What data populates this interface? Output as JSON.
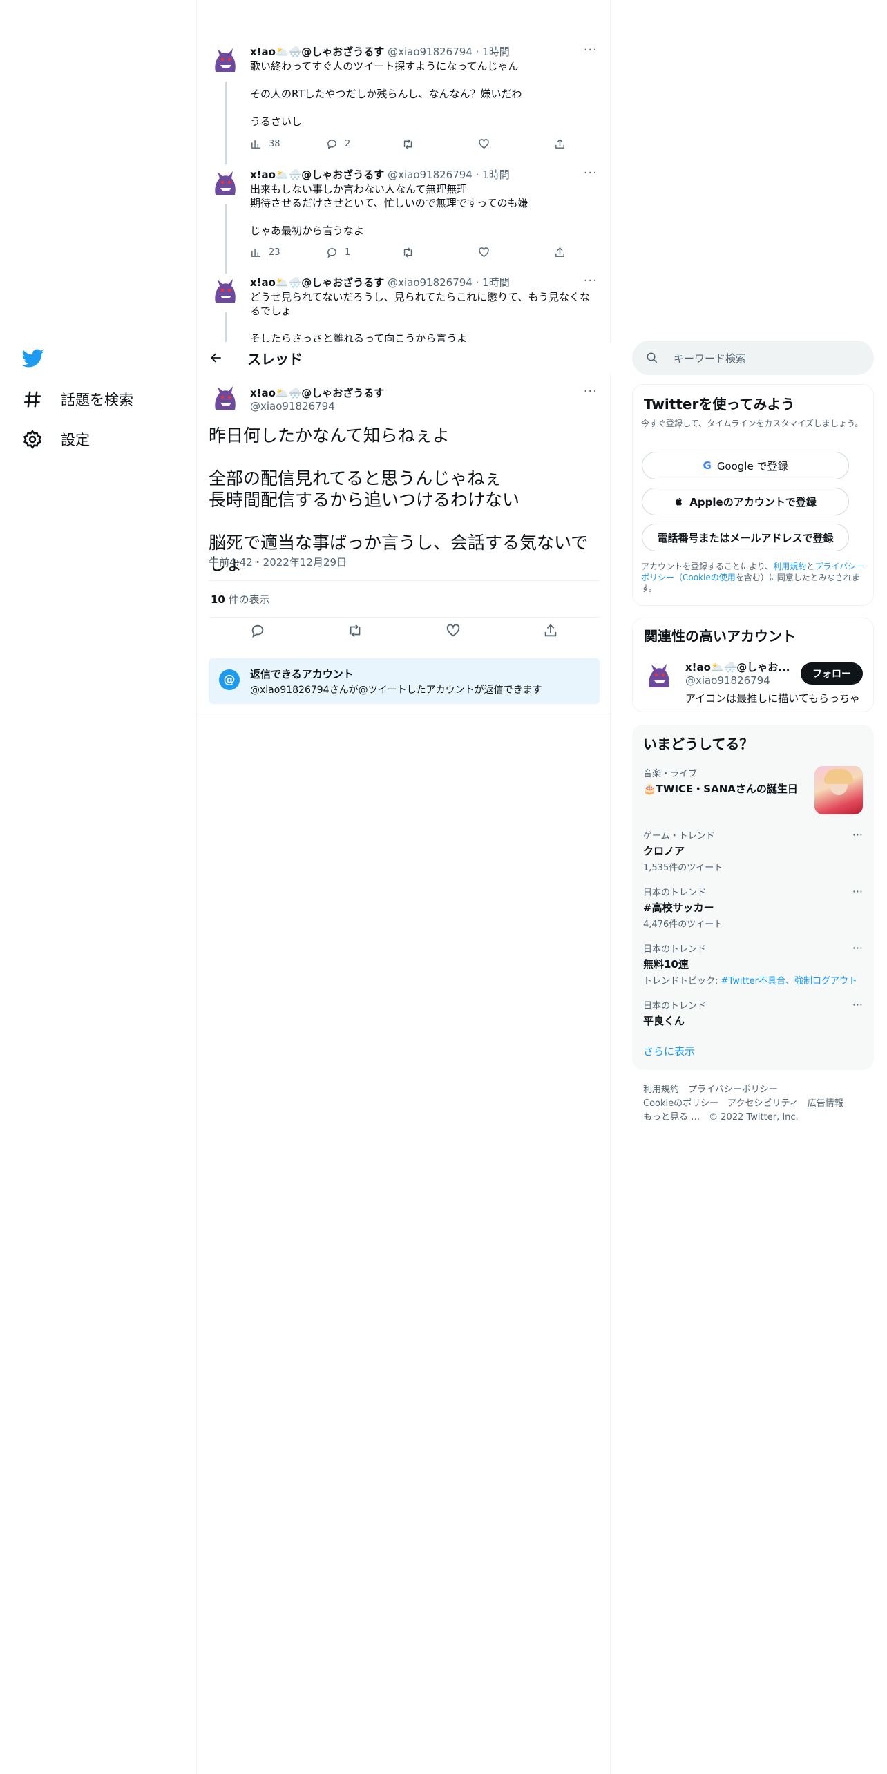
{
  "nav": {
    "items": [
      {
        "label": "話題を検索",
        "icon": "hashtag-icon"
      },
      {
        "label": "設定",
        "icon": "gear-icon"
      }
    ]
  },
  "thread_replies": [
    {
      "name": "x!ao🌥️🌨️@しゃおざうるす",
      "handle": "@xiao91826794",
      "time": "· 1時間",
      "text": "歌い終わってすぐ人のツイート探すようになってんじゃん\n\nその人のRTしたやつだしか残らんし、なんなん？嫌いだわ\n\nうるさいし",
      "views": "38",
      "replies": "2"
    },
    {
      "name": "x!ao🌥️🌨️@しゃおざうるす",
      "handle": "@xiao91826794",
      "time": "· 1時間",
      "text": "出来もしない事しか言わない人なんて無理無理\n期待させるだけさせといて、忙しいので無理ですってのも嫌\n\nじゃあ最初から言うなよ",
      "views": "23",
      "replies": "1"
    },
    {
      "name": "x!ao🌥️🌨️@しゃおざうるす",
      "handle": "@xiao91826794",
      "time": "· 1時間",
      "text": "どうせ見られてないだろうし、見られてたらこれに懲りて、もう見なくなるでしょ\n\nそしたらさっさと離れるって向こうから言うよ"
    }
  ],
  "thread_header": {
    "title": "スレッド"
  },
  "main_tweet": {
    "name": "x!ao🌥️🌨️@しゃおざうるす",
    "handle": "@xiao91826794",
    "text": "昨日何したかなんて知らねぇよ\n\n全部の配信見れてると思うんじゃねぇ\n長時間配信するから追いつけるわけない\n\n脳死で適当な事ばっか言うし、会話する気ないでしょ",
    "timestamp": "午前4:42・2022年12月29日",
    "view_count": "10",
    "view_label": " 件の表示"
  },
  "reply_restriction": {
    "icon": "at-icon",
    "title": "返信できるアカウント",
    "text": "@xiao91826794さんが@ツイートしたアカウントが返信できます"
  },
  "sidebar": {
    "search_placeholder": "キーワード検索",
    "signup": {
      "title": "Twitterを使ってみよう",
      "subtitle": "今すぐ登録して、タイムラインをカスタマイズしましょう。",
      "google": "Google で登録",
      "apple": "Appleのアカウントで登録",
      "phone": "電話番号またはメールアドレスで登録",
      "legal_1": "アカウントを登録することにより、",
      "legal_terms": "利用規約",
      "legal_2": "と",
      "legal_privacy": "プライバシーポリシー（Cookieの使用",
      "legal_3": "を含む）に同意したとみなされます。"
    },
    "related": {
      "title": "関連性の高いアカウント",
      "name": "x!ao🌥️🌨️@しゃお...",
      "handle": "@xiao91826794",
      "bio": "アイコンは最推しに描いてもらっちゃ",
      "follow": "フォロー"
    },
    "trends": {
      "title": "いまどうしてる？",
      "featured": {
        "category": "音楽・ライブ",
        "title": "🎂TWICE・SANAさんの誕生日"
      },
      "items": [
        {
          "category": "ゲーム・トレンド",
          "title": "クロノア",
          "sub": "1,535件のツイート"
        },
        {
          "category": "日本のトレンド",
          "title": "#高校サッカー",
          "sub": "4,476件のツイート"
        },
        {
          "category": "日本のトレンド",
          "title": "無料10連",
          "sub_prefix": "トレンドトピック: ",
          "sub_link": "#Twitter不具合、強制ログアウト"
        },
        {
          "category": "日本のトレンド",
          "title": "平良くん"
        }
      ],
      "more": "さらに表示"
    },
    "footer": {
      "line1": "利用規約　プライバシーポリシー",
      "line2": "Cookieのポリシー　アクセシビリティ　広告情報",
      "more": "もっと見る …",
      "copyright": "© 2022 Twitter, Inc."
    }
  },
  "colors": {
    "accent": "#1d9bf0",
    "text": "#0f1419",
    "muted": "#536471"
  }
}
